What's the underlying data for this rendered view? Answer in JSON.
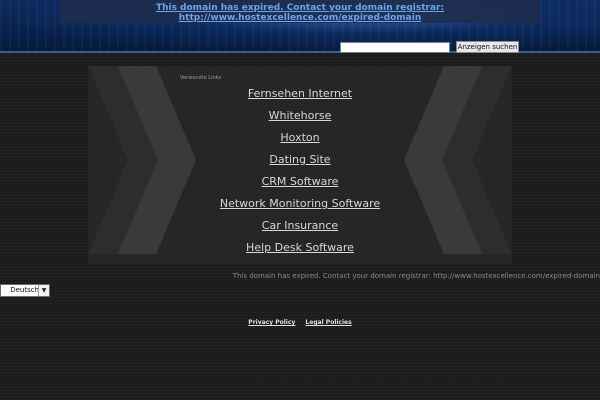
{
  "banner": {
    "notice_text": "This domain has expired. Contact your domain registrar: http://www.hostexcellence.com/expired-domain"
  },
  "search": {
    "input_value": "",
    "button_label": "Anzeigen suchen"
  },
  "related": {
    "title": "Verwandte Links",
    "links": [
      "Fernsehen Internet",
      "Whitehorse",
      "Hoxton",
      "Dating Site",
      "CRM Software",
      "Network Monitoring Software",
      "Car Insurance",
      "Help Desk Software"
    ]
  },
  "footer": {
    "note": "This domain has expired. Contact your domain registrar: http://www.hostexcellence.com/expired-domain",
    "language_selected": "Deutsch",
    "privacy_label": "Privacy Policy",
    "legal_label": "Legal Policies"
  },
  "colors": {
    "banner_blue": "#0a2552",
    "notice_link": "#6fa3e8",
    "background": "#1d1d1d",
    "panel": "#262626",
    "link_text": "#d4d8df"
  }
}
